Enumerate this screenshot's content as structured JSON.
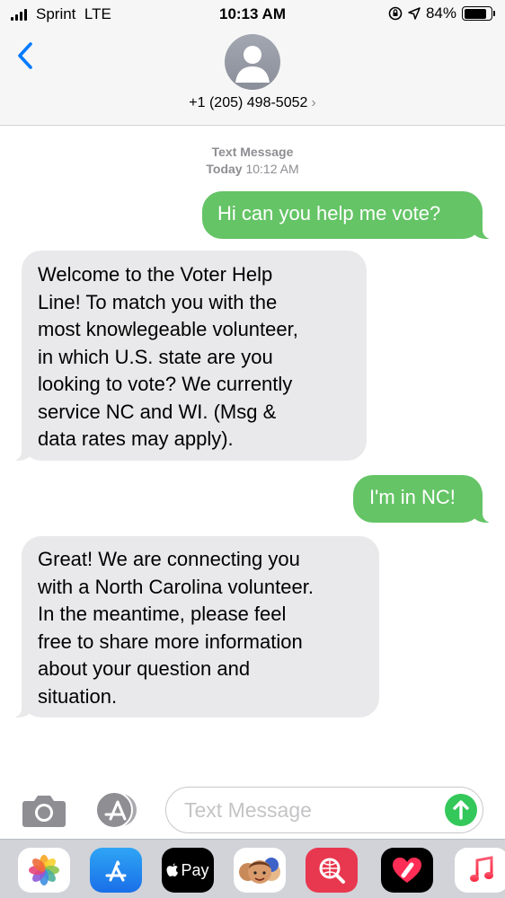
{
  "status_bar": {
    "carrier": "Sprint",
    "network": "LTE",
    "time": "10:13 AM",
    "battery_percent": "84%",
    "battery_level": 0.84
  },
  "header": {
    "back_icon": "chevron-left-icon",
    "contact_phone": "+1 (205) 498-5052",
    "chevron": "›"
  },
  "timestamp": {
    "label": "Text Message",
    "day": "Today",
    "time": "10:12 AM"
  },
  "messages": [
    {
      "direction": "outgoing",
      "text": "Hi can you help me vote?"
    },
    {
      "direction": "incoming",
      "text": "Welcome to the Voter Help\nLine! To match you with the\nmost knowlegeable volunteer,\nin which U.S. state are you\nlooking to vote? We currently\nservice NC and WI. (Msg &\ndata rates may apply)."
    },
    {
      "direction": "outgoing",
      "text": "I'm in NC!"
    },
    {
      "direction": "incoming",
      "text": "Great! We are connecting you\nwith a North Carolina volunteer.\nIn the meantime, please feel\nfree to share more information\nabout your question and\nsituation."
    }
  ],
  "input": {
    "placeholder": "Text Message",
    "value": ""
  },
  "app_drawer": {
    "apple_pay_label": "Pay",
    "apps": [
      "photos-icon",
      "app-store-icon",
      "apple-pay-icon",
      "memoji-icon",
      "search-images-icon",
      "digital-touch-icon",
      "music-icon"
    ]
  },
  "colors": {
    "outgoing_bubble": "#65c466",
    "incoming_bubble": "#e9e9eb",
    "accent": "#007aff",
    "send_button": "#34c759"
  }
}
